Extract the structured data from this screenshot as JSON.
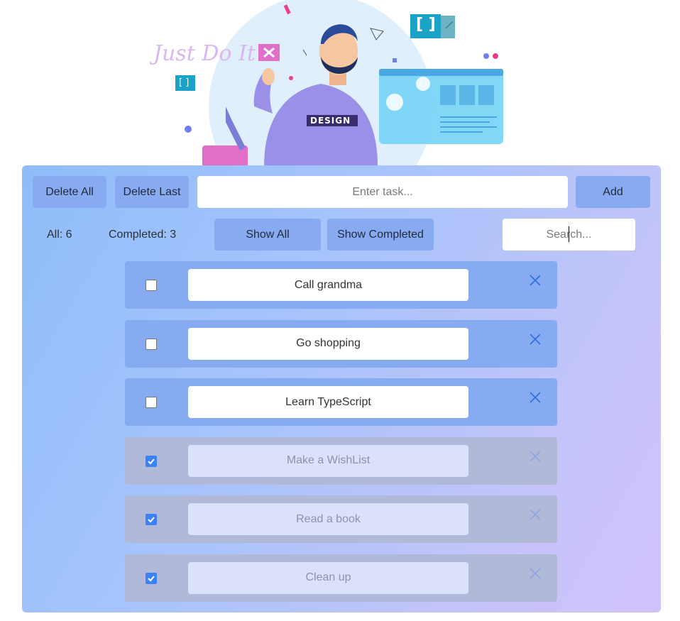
{
  "hero": {
    "slogan": "Just Do It",
    "shirt_text": "DESIGN",
    "bracket_label": "[ ]"
  },
  "toolbar": {
    "delete_all_label": "Delete All",
    "delete_last_label": "Delete Last",
    "task_placeholder": "Enter task...",
    "add_label": "Add"
  },
  "filters": {
    "all_text": "All: 6",
    "completed_text": "Completed: 3",
    "show_all_label": "Show All",
    "show_completed_label": "Show Completed",
    "search_placeholder": "Search..."
  },
  "tasks": [
    {
      "text": "Call grandma",
      "completed": false
    },
    {
      "text": "Go shopping",
      "completed": false
    },
    {
      "text": "Learn TypeScript",
      "completed": false
    },
    {
      "text": "Make a WishList",
      "completed": true
    },
    {
      "text": "Read a book",
      "completed": true
    },
    {
      "text": "Clean up",
      "completed": true
    }
  ],
  "colors": {
    "button": "#87aaf1",
    "task_active": "#86abf1",
    "task_done": "#b0b9d8",
    "checkbox_checked": "#3b82f6"
  }
}
